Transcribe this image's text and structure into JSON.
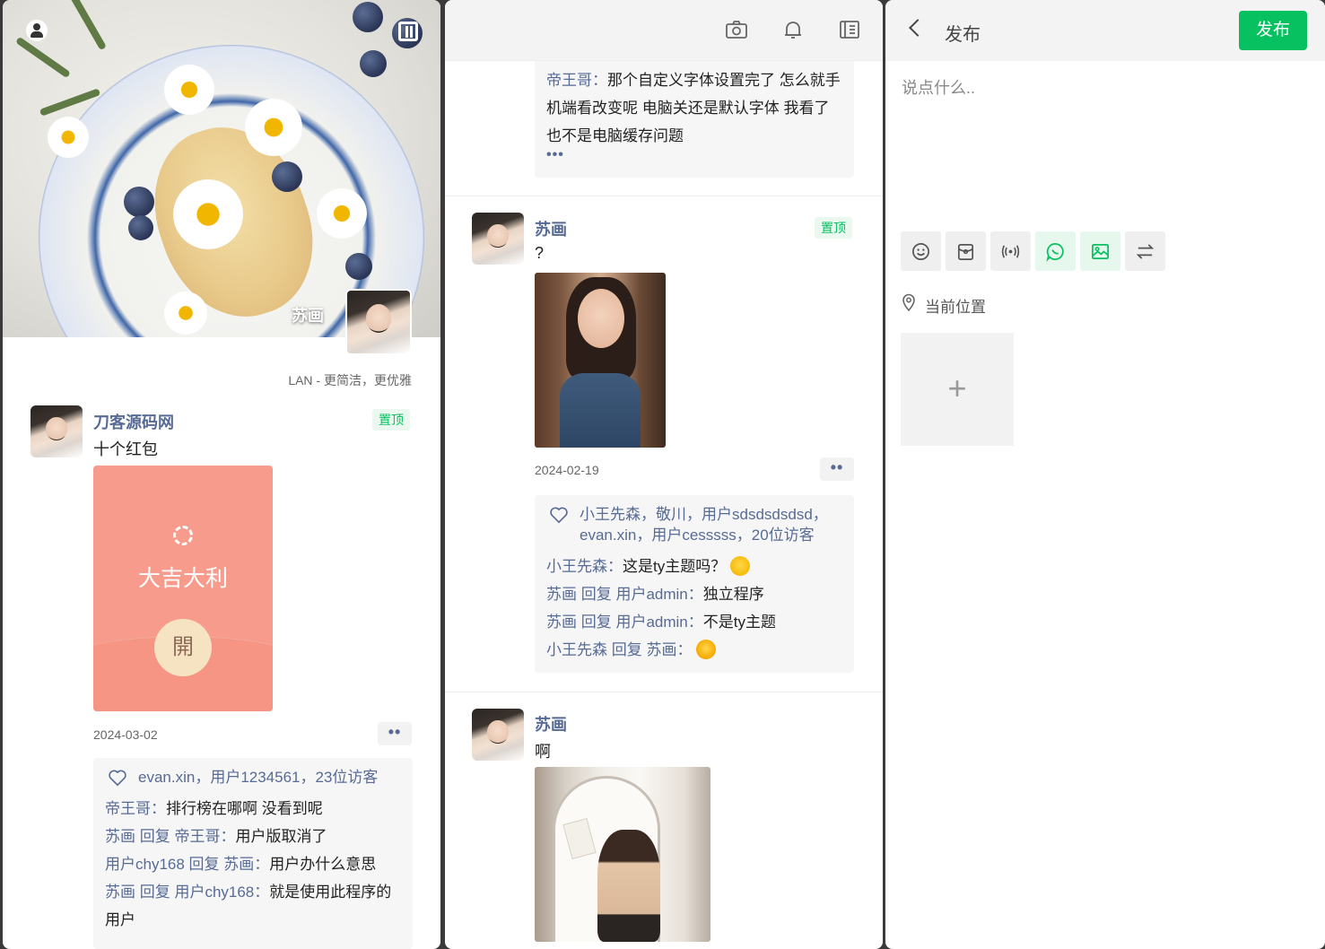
{
  "profile": {
    "cover_name": "苏画",
    "tagline": "LAN - 更简洁，更优雅"
  },
  "feed_left": {
    "post": {
      "author": "刀客源码网",
      "pin_label": "置顶",
      "text": "十个红包",
      "red_packet": {
        "title": "大吉大利",
        "open_label": "開"
      },
      "date": "2024-03-02",
      "more_label": "••",
      "likes": "evan.xin，用户1234561，23位访客",
      "comments": [
        {
          "who": "帝王哥：",
          "text": "排行榜在哪啊 没看到呢"
        },
        {
          "who": "苏画 回复 帝王哥：",
          "text": "用户版取消了"
        },
        {
          "who": "用户chy168 回复 苏画：",
          "text": "用户办什么意思"
        },
        {
          "who": "苏画 回复 用户chy168：",
          "text": "就是使用此程序的用户"
        }
      ]
    }
  },
  "feed_middle": {
    "top_comment": {
      "who": "帝王哥：",
      "text": "那个自定义字体设置完了 怎么就手机端看改变呢 电脑关还是默认字体 我看了也不是电脑缓存问题",
      "ellipsis": "•••"
    },
    "post1": {
      "author": "苏画",
      "pin_label": "置顶",
      "text": "?",
      "date": "2024-02-19",
      "more_label": "••",
      "likes": "小王先森，敬川，用户sdsdsdsdsd，evan.xin，用户cesssss，20位访客",
      "comments": [
        {
          "who": "小王先森：",
          "text": "这是ty主题吗？"
        },
        {
          "who": "苏画 回复 用户admin：",
          "text": "独立程序"
        },
        {
          "who": "苏画 回复 用户admin：",
          "text": "不是ty主题"
        },
        {
          "who": "小王先森 回复 苏画：",
          "text": ""
        }
      ]
    },
    "post2": {
      "author": "苏画",
      "text": "啊"
    }
  },
  "composer": {
    "title": "发布",
    "publish_label": "发布",
    "placeholder": "说点什么..",
    "location_label": "当前位置",
    "add_label": "+",
    "tools": [
      "smile-icon",
      "bag-icon",
      "broadcast-icon",
      "chat-icon",
      "image-icon",
      "swap-icon"
    ]
  },
  "colors": {
    "accent_green": "#07c160",
    "link_blue": "#576b95",
    "red_packet": "#f79c8c"
  }
}
